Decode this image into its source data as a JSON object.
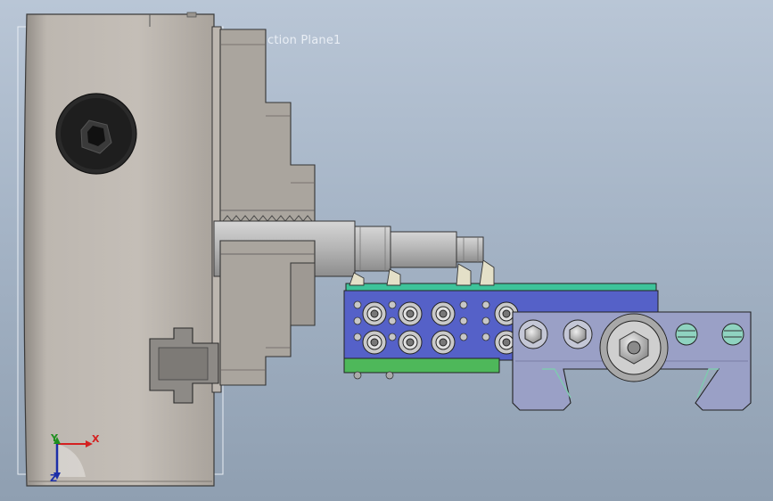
{
  "viewport": {
    "section_plane_label": "ction Plane1",
    "background_colors": {
      "top": "#b9c6d6",
      "bottom": "#8f9fb1"
    }
  },
  "model": {
    "chuck": {
      "color": "#b8b2ab",
      "jaw_color": "#aaa59e",
      "key_socket": "hex-socket"
    },
    "spindle": {
      "color": "#b9b9b9"
    },
    "tool_block": {
      "top_color": "#3dc39a",
      "body_color": "#5561c8",
      "base_color": "#4eb85a"
    },
    "clamp_bracket": {
      "color": "#9aa0c6"
    }
  },
  "triad": {
    "x": "X",
    "y": "Y",
    "z": "Z",
    "colors": {
      "x": "#d42020",
      "y": "#1f8f1f",
      "z": "#1c2fa8"
    }
  }
}
